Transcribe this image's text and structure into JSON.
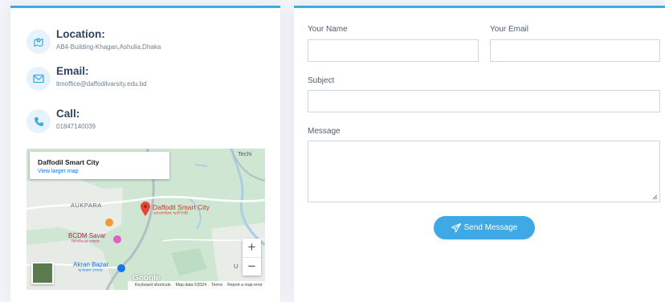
{
  "contact": {
    "location": {
      "title": "Location:",
      "value": "AB4-Building-Khagan,Ashulia,Dhaka",
      "icon": "map-marker-icon"
    },
    "email": {
      "title": "Email:",
      "value": "itmoffice@daffodilvarsity.edu.bd",
      "icon": "envelope-icon"
    },
    "call": {
      "title": "Call:",
      "value": "01847140039",
      "icon": "phone-icon"
    }
  },
  "map": {
    "place_name": "Daffodil Smart City",
    "view_larger": "View larger map",
    "pin_label": "Daffodil Smart City",
    "pin_sublabel": "ড্যাফোডিল স্মার্ট সিটি",
    "labels": {
      "aukpara": "AUKPARA",
      "bcdm": "BCDM Savar",
      "bcdm_sub": "বিসিডিএম সাভার",
      "akran": "Akran Bazar",
      "akran_sub": "আকরান বাজার",
      "tech": "Techi",
      "u": "U"
    },
    "zoom_in": "+",
    "zoom_out": "−",
    "google": "Google",
    "attribution": {
      "shortcuts": "Keyboard shortcuts",
      "data": "Map data ©2024",
      "terms": "Terms",
      "report": "Report a map error"
    }
  },
  "form": {
    "name_label": "Your Name",
    "email_label": "Your Email",
    "subject_label": "Subject",
    "message_label": "Message",
    "submit_label": "Send Message",
    "submit_icon": "paper-plane-icon"
  },
  "colors": {
    "accent": "#3fa9e6",
    "heading": "#2e4460"
  }
}
